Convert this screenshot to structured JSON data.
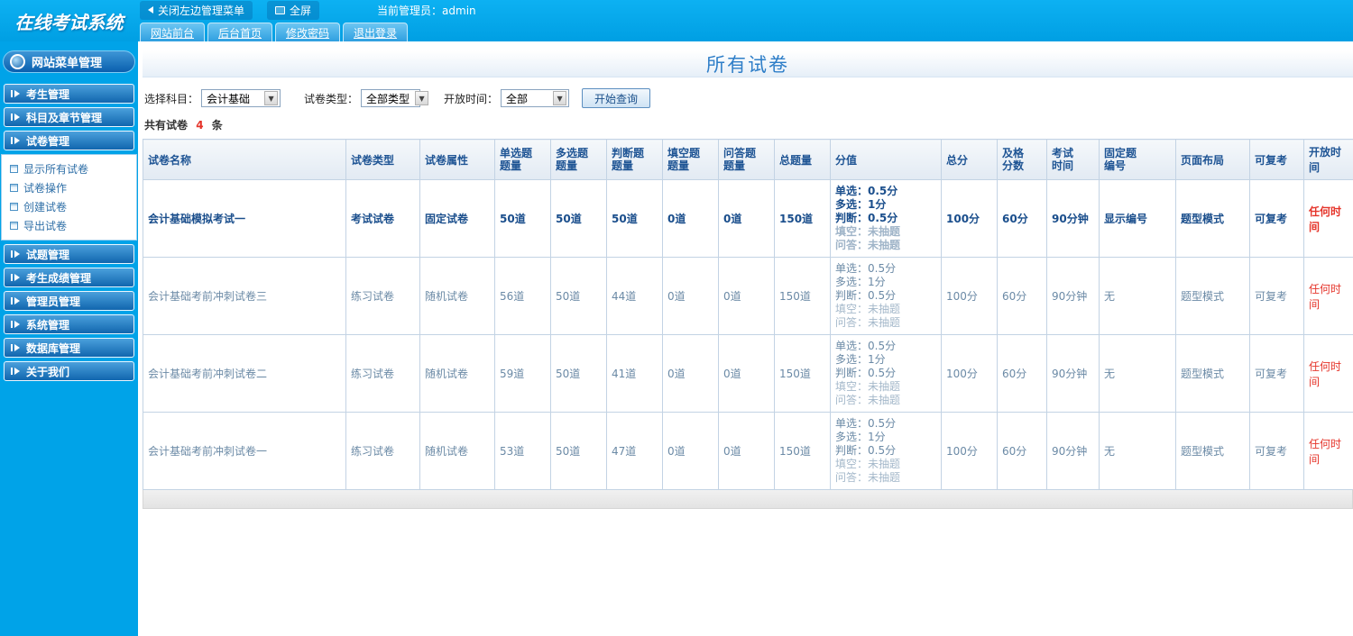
{
  "topbar": {
    "logo": "在线考试系统",
    "close_menu": "关闭左边管理菜单",
    "fullscreen": "全屏",
    "admin": "当前管理员：admin",
    "tabs": [
      "网站前台",
      "后台首页",
      "修改密码",
      "退出登录"
    ]
  },
  "sidebar": {
    "title": "网站菜单管理",
    "menu_top": [
      "考生管理",
      "科目及章节管理",
      "试卷管理"
    ],
    "submenu": [
      "显示所有试卷",
      "试卷操作",
      "创建试卷",
      "导出试卷"
    ],
    "menu_bottom": [
      "试题管理",
      "考生成绩管理",
      "管理员管理",
      "系统管理",
      "数据库管理",
      "关于我们"
    ]
  },
  "main": {
    "title": "所有试卷",
    "filters": {
      "subject_label": "选择科目：",
      "subject_value": "会计基础",
      "type_label": "试卷类型：",
      "type_value": "全部类型",
      "time_label": "开放时间：",
      "time_value": "全部",
      "query_button": "开始查询"
    },
    "summary": {
      "prefix": "共有试卷",
      "count": "4",
      "suffix": "条"
    },
    "table": {
      "headers": [
        "试卷名称",
        "试卷类型",
        "试卷属性",
        "单选题题量",
        "多选题题量",
        "判断题题量",
        "填空题题量",
        "问答题题量",
        "总题量",
        "分值",
        "总分",
        "及格分数",
        "考试时间",
        "固定题编号",
        "页面布局",
        "可复考",
        "开放时间"
      ],
      "rows": [
        {
          "name": "会计基础模拟考试一",
          "type": "考试试卷",
          "attr": "固定试卷",
          "single": "50道",
          "multiple": "50道",
          "judge": "50道",
          "blank": "0道",
          "qa": "0道",
          "total": "150道",
          "score_lines": [
            "单选：0.5分",
            "多选：1分",
            "判断：0.5分",
            "填空：未抽题",
            "问答：未抽题"
          ],
          "total_score": "100分",
          "pass_score": "60分",
          "duration": "90分钟",
          "fixed_no": "显示编号",
          "layout": "题型模式",
          "retake": "可复考",
          "open_time": "任何时间"
        },
        {
          "name": "会计基础考前冲刺试卷三",
          "type": "练习试卷",
          "attr": "随机试卷",
          "single": "56道",
          "multiple": "50道",
          "judge": "44道",
          "blank": "0道",
          "qa": "0道",
          "total": "150道",
          "score_lines": [
            "单选：0.5分",
            "多选：1分",
            "判断：0.5分",
            "填空：未抽题",
            "问答：未抽题"
          ],
          "total_score": "100分",
          "pass_score": "60分",
          "duration": "90分钟",
          "fixed_no": "无",
          "layout": "题型模式",
          "retake": "可复考",
          "open_time": "任何时间"
        },
        {
          "name": "会计基础考前冲刺试卷二",
          "type": "练习试卷",
          "attr": "随机试卷",
          "single": "59道",
          "multiple": "50道",
          "judge": "41道",
          "blank": "0道",
          "qa": "0道",
          "total": "150道",
          "score_lines": [
            "单选：0.5分",
            "多选：1分",
            "判断：0.5分",
            "填空：未抽题",
            "问答：未抽题"
          ],
          "total_score": "100分",
          "pass_score": "60分",
          "duration": "90分钟",
          "fixed_no": "无",
          "layout": "题型模式",
          "retake": "可复考",
          "open_time": "任何时间"
        },
        {
          "name": "会计基础考前冲刺试卷一",
          "type": "练习试卷",
          "attr": "随机试卷",
          "single": "53道",
          "multiple": "50道",
          "judge": "47道",
          "blank": "0道",
          "qa": "0道",
          "total": "150道",
          "score_lines": [
            "单选：0.5分",
            "多选：1分",
            "判断：0.5分",
            "填空：未抽题",
            "问答：未抽题"
          ],
          "total_score": "100分",
          "pass_score": "60分",
          "duration": "90分钟",
          "fixed_no": "无",
          "layout": "题型模式",
          "retake": "可复考",
          "open_time": "任何时间"
        }
      ]
    }
  }
}
